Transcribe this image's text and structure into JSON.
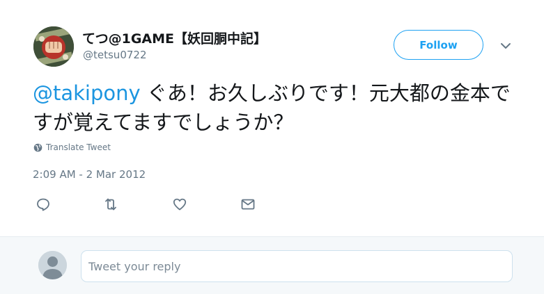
{
  "author": {
    "display_name": "てつ@1GAME【妖回胴中記】",
    "screen_name": "@tetsu0722",
    "avatar_icon": "fist-avatar-icon"
  },
  "follow_label": "Follow",
  "tweet": {
    "mention": "@takipony",
    "text": " ぐあ！お久しぶりです！元大都の金本ですが覚えてますでしょうか？",
    "translate_label": "Translate Tweet",
    "timestamp": "2:09 AM - 2 Mar 2012"
  },
  "actions": {
    "reply_icon": "reply-icon",
    "retweet_icon": "retweet-icon",
    "like_icon": "heart-icon",
    "dm_icon": "envelope-icon"
  },
  "reply": {
    "placeholder": "Tweet your reply"
  },
  "colors": {
    "accent": "#1da1f2",
    "mention": "#1b95e0",
    "secondary_text": "#657786",
    "reply_bg": "#f5f8fa"
  }
}
